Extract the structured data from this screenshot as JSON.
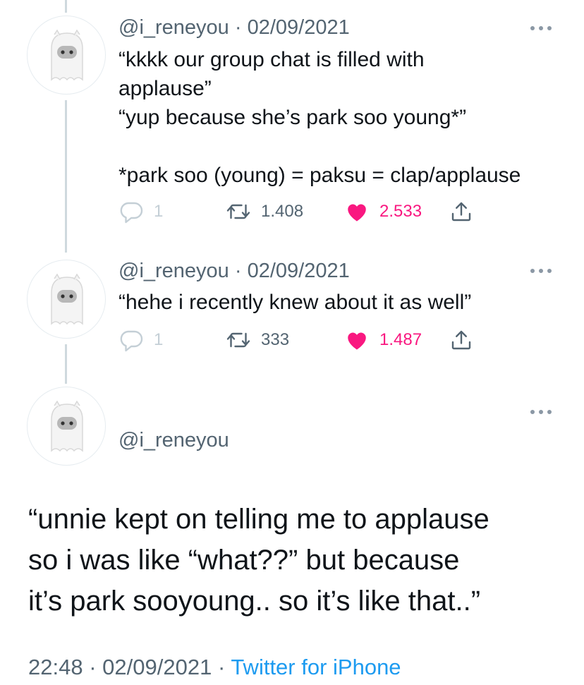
{
  "tweets": [
    {
      "handle": "@i_reneyou",
      "date": "02/09/2021",
      "lines": [
        "“kkkk our group chat is filled with",
        "applause”",
        "“yup because she’s park soo young*”",
        "",
        "*park soo (young) = paksu = clap/applause"
      ],
      "reply_count": "1",
      "retweet_count": "1.408",
      "like_count": "2.533"
    },
    {
      "handle": "@i_reneyou",
      "date": "02/09/2021",
      "lines": [
        "“hehe i recently knew about it as well”"
      ],
      "reply_count": "1",
      "retweet_count": "333",
      "like_count": "1.487"
    }
  ],
  "main_tweet": {
    "handle": "@i_reneyou",
    "lines": [
      "“unnie kept on telling me to applause",
      "so i was like “what??” but because",
      "it’s park sooyoung.. so it’s like that..”"
    ],
    "time": "22:48",
    "date": "02/09/2021",
    "separator": "·",
    "source": "Twitter for iPhone"
  },
  "icons": {
    "avatar": "ghost-avatar-icon",
    "more": "more-dots-icon",
    "reply": "reply-icon",
    "retweet": "retweet-icon",
    "like": "heart-icon",
    "share": "share-icon"
  },
  "colors": {
    "text": "#0f1419",
    "secondary": "#536471",
    "like": "#f91880",
    "link": "#1d9bf0",
    "thread_line": "#cfd9de"
  }
}
